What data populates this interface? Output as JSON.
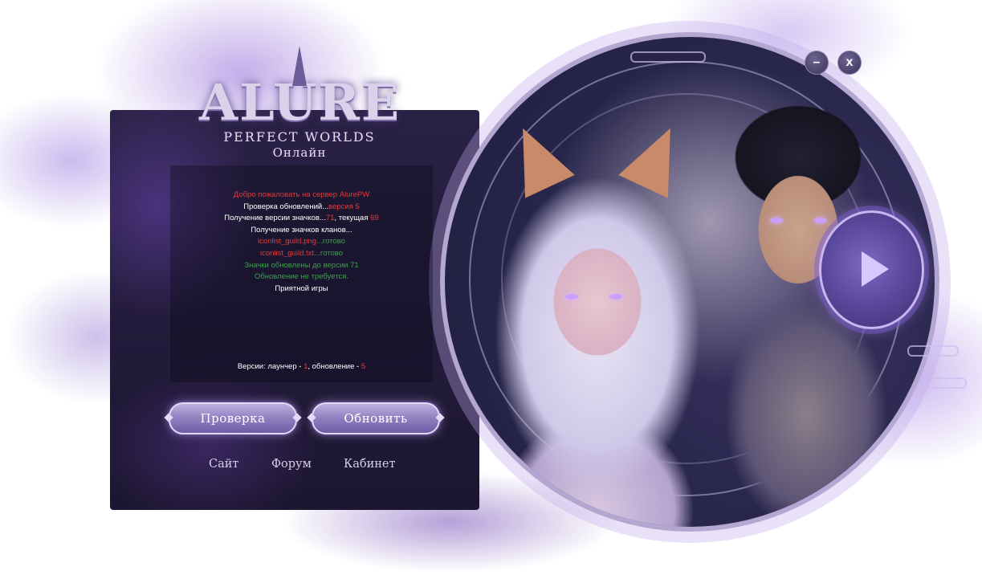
{
  "logo": {
    "title": "ALURE",
    "subtitle": "PERFECT WORLDS",
    "tagline": "Онлайн"
  },
  "log": {
    "lines": [
      {
        "parts": [
          {
            "text": "Добро пожаловать на сервер ",
            "color": "red"
          },
          {
            "text": "AlurePW",
            "color": "red"
          }
        ]
      },
      {
        "parts": [
          {
            "text": "Проверка обновлений...",
            "color": "white"
          },
          {
            "text": "версия 5",
            "color": "red"
          }
        ]
      },
      {
        "parts": [
          {
            "text": "Получение версии значков...",
            "color": "white"
          },
          {
            "text": "71",
            "color": "red"
          },
          {
            "text": ", текущая ",
            "color": "white"
          },
          {
            "text": "69",
            "color": "red"
          }
        ]
      },
      {
        "parts": [
          {
            "text": "Получение значков кланов...",
            "color": "white"
          }
        ]
      },
      {
        "parts": [
          {
            "text": "iconlist_guild.png",
            "color": "red"
          },
          {
            "text": "...готово",
            "color": "green"
          }
        ]
      },
      {
        "parts": [
          {
            "text": "iconlist_guild.txt",
            "color": "red"
          },
          {
            "text": "...готово",
            "color": "green"
          }
        ]
      },
      {
        "parts": [
          {
            "text": "Значки обновлены до версии 71",
            "color": "green"
          }
        ]
      },
      {
        "parts": [
          {
            "text": "Обновление не требуется.",
            "color": "green"
          }
        ]
      },
      {
        "parts": [
          {
            "text": "Приятной игры",
            "color": "white"
          }
        ]
      }
    ],
    "version_line": {
      "prefix": "Версии: лаунчер - ",
      "launcher": "1",
      "middle": ", обновление - ",
      "update": "5"
    }
  },
  "buttons": {
    "check_label": "Проверка",
    "update_label": "Обновить"
  },
  "links": {
    "site": "Сайт",
    "forum": "Форум",
    "cabinet": "Кабинет"
  },
  "window": {
    "minimize_label": "–",
    "close_label": "x"
  },
  "icons": {
    "play": "play-icon",
    "minimize": "minimize-icon",
    "close": "close-icon"
  },
  "colors": {
    "log_white": "#ffffff",
    "log_red": "#e23b3b",
    "log_green": "#3aa14a",
    "accent": "#8f80c0"
  }
}
